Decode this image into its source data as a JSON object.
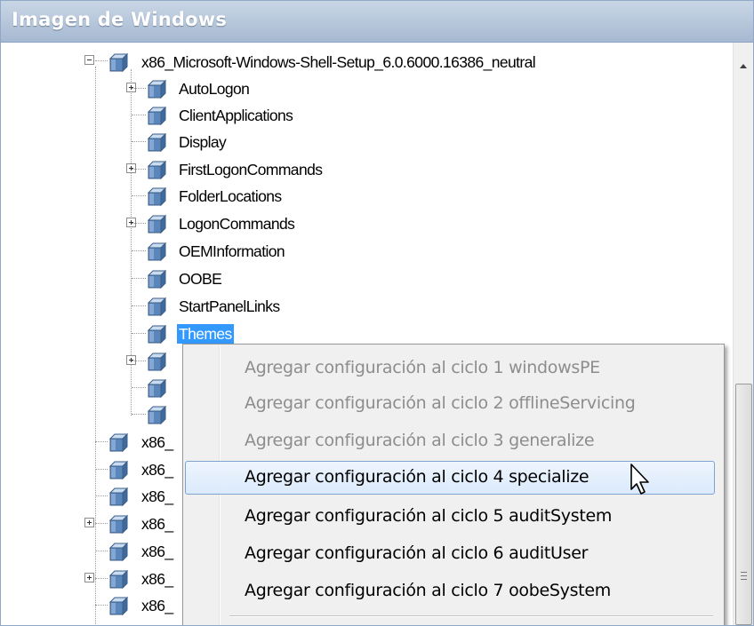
{
  "panel": {
    "title": "Imagen de Windows"
  },
  "tree": {
    "root": {
      "label": "x86_Microsoft-Windows-Shell-Setup_6.0.6000.16386_neutral",
      "icon": "component-cube-icon",
      "expanded": true
    },
    "children": [
      {
        "label": "AutoLogon",
        "expandable": true
      },
      {
        "label": "ClientApplications",
        "expandable": false
      },
      {
        "label": "Display",
        "expandable": false
      },
      {
        "label": "FirstLogonCommands",
        "expandable": true
      },
      {
        "label": "FolderLocations",
        "expandable": false
      },
      {
        "label": "LogonCommands",
        "expandable": true
      },
      {
        "label": "OEMInformation",
        "expandable": false
      },
      {
        "label": "OOBE",
        "expandable": false
      },
      {
        "label": "StartPanelLinks",
        "expandable": false
      },
      {
        "label": "Themes",
        "expandable": false,
        "selected": true
      },
      {
        "label": "",
        "expandable": true
      },
      {
        "label": "",
        "expandable": false
      },
      {
        "label": "",
        "expandable": false
      }
    ],
    "siblings": [
      {
        "label": "x86_",
        "expandable": false
      },
      {
        "label": "x86_",
        "expandable": false
      },
      {
        "label": "x86_",
        "expandable": false
      },
      {
        "label": "x86_",
        "expandable": true
      },
      {
        "label": "x86_",
        "expandable": false
      },
      {
        "label": "x86_",
        "expandable": true
      },
      {
        "label": "x86_",
        "expandable": false
      }
    ]
  },
  "context_menu": {
    "items": [
      {
        "label": "Agregar configuración al ciclo 1 windowsPE",
        "enabled": false
      },
      {
        "label": "Agregar configuración al ciclo 2 offlineServicing",
        "enabled": false
      },
      {
        "label": "Agregar configuración al ciclo 3 generalize",
        "enabled": false
      },
      {
        "label": "Agregar configuración al ciclo 4 specialize",
        "enabled": true,
        "highlighted": true
      },
      {
        "label": "Agregar configuración al ciclo 5 auditSystem",
        "enabled": true
      },
      {
        "label": "Agregar configuración al ciclo 6 auditUser",
        "enabled": true
      },
      {
        "label": "Agregar configuración al ciclo 7 oobeSystem",
        "enabled": true
      }
    ]
  },
  "colors": {
    "selection": "#3399ff",
    "title_bar": "#b4c5da",
    "menu_highlight_border": "#7da2ce",
    "cube_face": "#5b86bb"
  }
}
